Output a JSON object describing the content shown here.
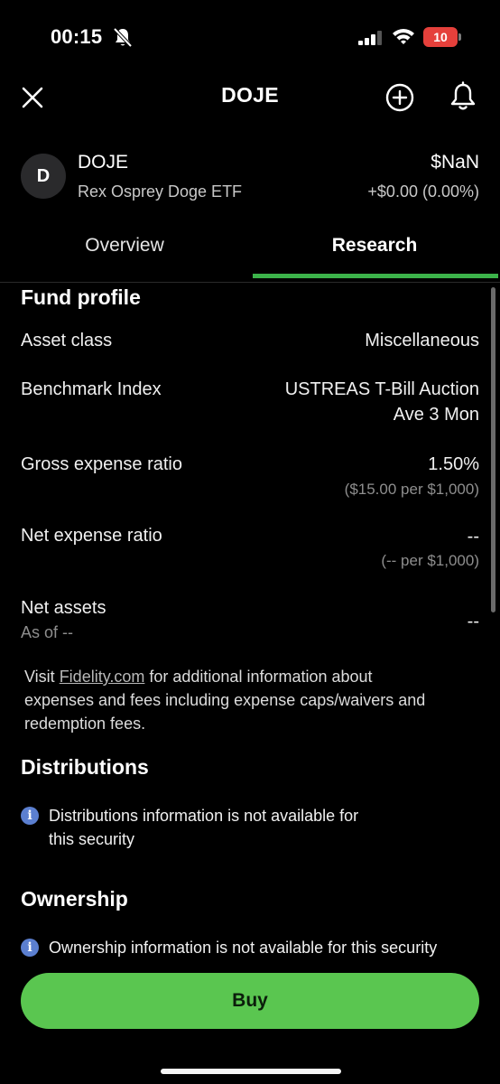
{
  "status_bar": {
    "time": "00:15",
    "battery": "10",
    "icons": [
      "bell-slash-icon",
      "signal-icon",
      "wifi-icon",
      "battery-charging-icon"
    ]
  },
  "header": {
    "title": "DOJE",
    "icons": [
      "close-icon",
      "plus-circle-icon",
      "bell-icon"
    ]
  },
  "security": {
    "avatar_letter": "D",
    "symbol": "DOJE",
    "name": "Rex Osprey Doge ETF",
    "price": "$NaN",
    "change": "+$0.00 (0.00%)"
  },
  "tabs": [
    {
      "label": "Overview",
      "active": false
    },
    {
      "label": "Research",
      "active": true
    }
  ],
  "fund_profile": {
    "title": "Fund profile",
    "asset_class": {
      "label": "Asset class",
      "value": "Miscellaneous"
    },
    "benchmark": {
      "label": "Benchmark Index",
      "value_line1": "USTREAS T-Bill Auction",
      "value_line2": "Ave 3 Mon"
    },
    "gross_expense": {
      "label": "Gross expense ratio",
      "value": "1.50%",
      "sub": "($15.00  per $1,000)"
    },
    "net_expense": {
      "label": "Net expense ratio",
      "value": "--",
      "sub": "(--  per $1,000)"
    },
    "net_assets": {
      "label": "Net assets",
      "sub": "As of --",
      "value": "--"
    }
  },
  "visit": {
    "prefix": "Visit ",
    "link": "Fidelity.com",
    "suffix_line1": " for additional information about",
    "line2": "expenses and fees including expense caps/waivers and",
    "line3": "redemption fees."
  },
  "distributions": {
    "title": "Distributions",
    "info_line1": "Distributions information is not available for",
    "info_line2": "this security"
  },
  "ownership": {
    "title": "Ownership",
    "info": "Ownership information is not available for this security"
  },
  "buy_button": "Buy",
  "colors": {
    "accent_green": "#3cb34a",
    "buy_green": "#5ac650",
    "battery_red": "#e5403b",
    "info_blue": "#5b7fd0"
  }
}
